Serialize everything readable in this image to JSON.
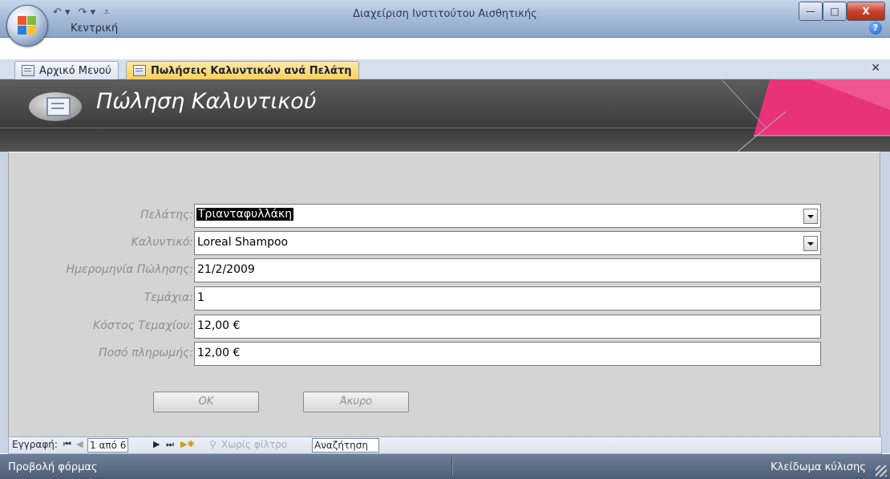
{
  "window": {
    "title": "Διαχείριση Ινστιτούτου Αισθητικής",
    "ribbon_tab": "Κεντρική",
    "qat": {
      "undo": "↶ ▾",
      "redo": "↷ ▾",
      "customize": "⩡"
    },
    "controls": {
      "minimize": "—",
      "maximize": "□",
      "close": "X"
    }
  },
  "doc_tabs": [
    {
      "label": "Αρχικό Μενού"
    },
    {
      "label": "Πωλήσεις Καλυντικών ανά Πελάτη"
    }
  ],
  "form": {
    "header_title": "Πώληση Καλυντικού",
    "fields": [
      {
        "label": "Πελάτης:",
        "value": "Τριανταφυλλάκη"
      },
      {
        "label": "Καλυντικό:",
        "value": "Loreal Shampoo"
      },
      {
        "label": "Ημερομηνία Πώλησης:",
        "value": "21/2/2009"
      },
      {
        "label": "Τεμάχια:",
        "value": "1"
      },
      {
        "label": "Κόστος Τεμαχίου:",
        "value": "12,00 €"
      },
      {
        "label": "Ποσό πληρωμής:",
        "value": "12,00 €"
      }
    ],
    "ok_label": "OK",
    "cancel_label": "Άκυρο"
  },
  "record_nav": {
    "label": "Εγγραφή:",
    "position": "1 από 6",
    "no_filter": "Χωρίς φίλτρο",
    "search": "Αναζήτηση"
  },
  "status_bar": {
    "view": "Προβολή φόρμας",
    "scroll_lock": "Κλείδωμα κύλισης"
  },
  "colors": {
    "accent_pink": "#e8327a",
    "header_dark": "#4a4a4a",
    "active_tab": "#ffcf5a",
    "detail_bg": "#d4d4d4"
  }
}
